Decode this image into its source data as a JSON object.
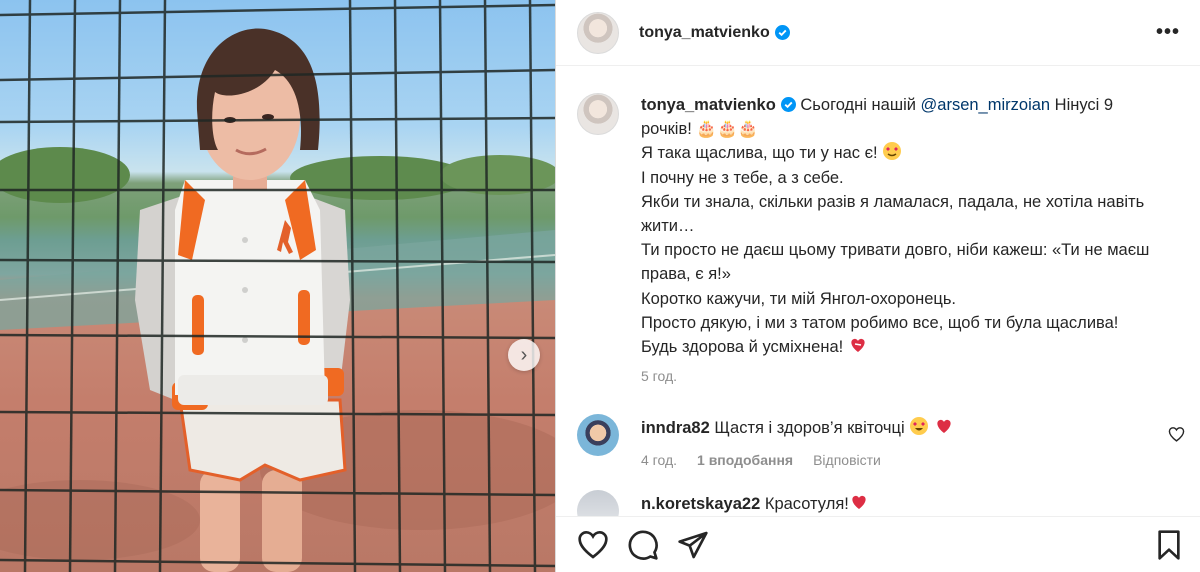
{
  "post": {
    "author": "tonya_matvienko",
    "more_label": "•••",
    "caption": {
      "author": "tonya_matvienko",
      "line1_pre": "Сьогодні нашій ",
      "mention": "@arsen_mirzoian",
      "line1_post": " Нінусі 9 рочків! ",
      "line1_emoji": "🎂🎂🎂",
      "line2": "Я така щаслива, що ти у нас є! ",
      "line3": "І почну не з тебе, а з себе.",
      "line4": "Якби ти знала, скільки разів я ламалася, падала, не хотіла навіть жити…",
      "line5": "Ти просто не даєш цьому тривати довго, ніби кажеш: «Ти не маєш права, є я!»",
      "line6": "Коротко кажучи, ти мій Янгол-охоронець.",
      "line7": "Просто дякую, і ми з татом робимо все, щоб ти була щаслива!",
      "line8": "Будь здорова й усміхнена! "
    },
    "time": "5 год."
  },
  "comments": [
    {
      "user": "inndra82",
      "text": "Щастя і здоров’я квіточці ",
      "time": "4 год.",
      "likes": "1 вподобання",
      "reply": "Відповісти"
    },
    {
      "user": "n.koretskaya22",
      "text": "Красотуля!"
    }
  ],
  "icons": {
    "verified": "verified-badge-icon",
    "like": "heart-icon",
    "comment": "comment-icon",
    "share": "paper-plane-icon",
    "save": "bookmark-icon",
    "next": "chevron-right-icon"
  },
  "colors": {
    "verified": "#0095f6",
    "mention": "#00376b",
    "muted": "#8e8e8e",
    "heart": "#ed4956"
  }
}
